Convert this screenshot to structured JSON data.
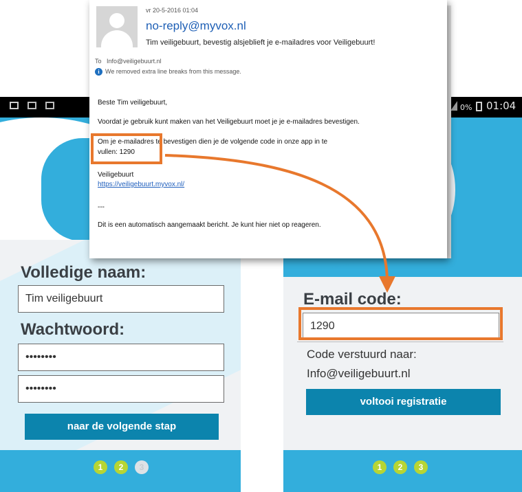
{
  "status_bar": {
    "battery_percent": "0%",
    "time": "01:04",
    "left_icons": [
      "image-icon",
      "mail-icon",
      "mail-icon"
    ]
  },
  "left_screen": {
    "name_label": "Volledige naam:",
    "name_value": "Tim veiligebuurt",
    "password_label": "Wachtwoord:",
    "password_value": "••••••••",
    "password_confirm_value": "••••••••",
    "next_button": "naar de volgende stap",
    "steps": [
      "1",
      "2",
      "3"
    ],
    "active_steps": 2
  },
  "right_screen": {
    "code_label": "E-mail code:",
    "code_value": "1290",
    "sent_to_label": "Code verstuurd naar:",
    "sent_to_value": "Info@veiligebuurt.nl",
    "finish_button": "voltooi registratie",
    "steps": [
      "1",
      "2",
      "3"
    ],
    "active_steps": 3
  },
  "email": {
    "date": "vr 20-5-2016 01:04",
    "from": "no-reply@myvox.nl",
    "subject": "Tim veiligebuurt, bevestig alsjeblieft je e-mailadres voor Veiligebuurt!",
    "to_label": "To",
    "to_value": "Info@veiligebuurt.nl",
    "info_notice": "We removed extra line breaks from this message.",
    "greeting": "Beste Tim veiligebuurt,",
    "paragraph": "Voordat je gebruik kunt maken van het Veiligebuurt moet je je e-mailadres bevestigen.",
    "code_line_1": "Om je e-mailadres te bevestigen dien je de volgende code in onze app in te",
    "code_line_2": "vullen: 1290",
    "signature": "Veiligebuurt",
    "link": "https://veiligebuurt.myvox.nl/",
    "separator": "---",
    "footer": "Dit is een automatisch aangemaakt bericht. Je kunt hier niet op reageren."
  },
  "colors": {
    "brand_blue": "#33aedc",
    "button_blue": "#0c84ad",
    "step_green": "#b7d534",
    "highlight_orange": "#e8782d",
    "link_blue": "#1e5fb5"
  }
}
